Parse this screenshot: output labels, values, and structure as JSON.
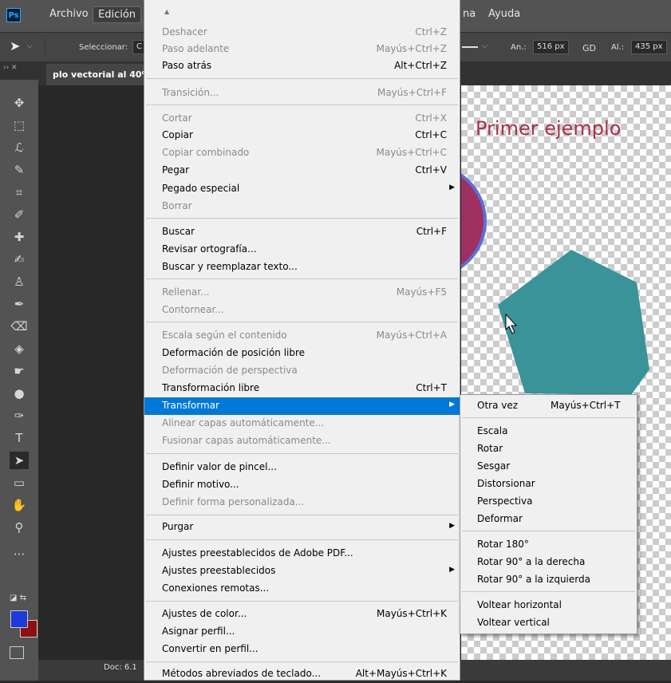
{
  "menubar": {
    "logo": "Ps",
    "items": [
      "Archivo",
      "Edición"
    ],
    "right_items": [
      "na",
      "Ayuda"
    ]
  },
  "options": {
    "select_label": "Seleccionar:",
    "select_value": "C",
    "width_label": "An.:",
    "width_value": "516 px",
    "link_icon": "GD",
    "height_label": "Al.:",
    "height_value": "435 px"
  },
  "document": {
    "tab_title": "plo vectorial al 40% (I",
    "canvas_title": "Primer ejemplo",
    "status": "Doc: 6.1"
  },
  "colors": {
    "foreground": "#1e3ad8",
    "background": "#8e1010",
    "hexagon": "#3a9399",
    "circle": "#9e3062",
    "circle_stroke": "#5b6fd6",
    "highlight": "#0078d7"
  },
  "main_menu": {
    "items": [
      {
        "label": "Deshacer",
        "shortcut": "Ctrl+Z",
        "disabled": true
      },
      {
        "label": "Paso adelante",
        "shortcut": "Mayús+Ctrl+Z",
        "disabled": true
      },
      {
        "label": "Paso atrás",
        "shortcut": "Alt+Ctrl+Z",
        "disabled": false
      },
      {
        "label": "Transición...",
        "shortcut": "Mayús+Ctrl+F",
        "disabled": true
      },
      {
        "label": "Cortar",
        "shortcut": "Ctrl+X",
        "disabled": true
      },
      {
        "label": "Copiar",
        "shortcut": "Ctrl+C",
        "disabled": false
      },
      {
        "label": "Copiar combinado",
        "shortcut": "Mayús+Ctrl+C",
        "disabled": true
      },
      {
        "label": "Pegar",
        "shortcut": "Ctrl+V",
        "disabled": false
      },
      {
        "label": "Pegado especial",
        "shortcut": "",
        "disabled": false,
        "submenu": true
      },
      {
        "label": "Borrar",
        "shortcut": "",
        "disabled": true
      },
      {
        "label": "Buscar",
        "shortcut": "Ctrl+F",
        "disabled": false
      },
      {
        "label": "Revisar ortografía...",
        "shortcut": "",
        "disabled": false
      },
      {
        "label": "Buscar y reemplazar texto...",
        "shortcut": "",
        "disabled": false
      },
      {
        "label": "Rellenar...",
        "shortcut": "Mayús+F5",
        "disabled": true
      },
      {
        "label": "Contornear...",
        "shortcut": "",
        "disabled": true
      },
      {
        "label": "Escala según el contenido",
        "shortcut": "Mayús+Ctrl+A",
        "disabled": true
      },
      {
        "label": "Deformación de posición libre",
        "shortcut": "",
        "disabled": false
      },
      {
        "label": "Deformación de perspectiva",
        "shortcut": "",
        "disabled": true
      },
      {
        "label": "Transformación libre",
        "shortcut": "Ctrl+T",
        "disabled": false
      },
      {
        "label": "Transformar",
        "shortcut": "",
        "disabled": false,
        "submenu": true,
        "highlighted": true
      },
      {
        "label": "Alinear capas automáticamente...",
        "shortcut": "",
        "disabled": true
      },
      {
        "label": "Fusionar capas automáticamente...",
        "shortcut": "",
        "disabled": true
      },
      {
        "label": "Definir valor de pincel...",
        "shortcut": "",
        "disabled": false
      },
      {
        "label": "Definir motivo...",
        "shortcut": "",
        "disabled": false
      },
      {
        "label": "Definir forma personalizada...",
        "shortcut": "",
        "disabled": true
      },
      {
        "label": "Purgar",
        "shortcut": "",
        "disabled": false,
        "submenu": true
      },
      {
        "label": "Ajustes preestablecidos de Adobe PDF...",
        "shortcut": "",
        "disabled": false
      },
      {
        "label": "Ajustes preestablecidos",
        "shortcut": "",
        "disabled": false,
        "submenu": true
      },
      {
        "label": "Conexiones remotas...",
        "shortcut": "",
        "disabled": false
      },
      {
        "label": "Ajustes de color...",
        "shortcut": "Mayús+Ctrl+K",
        "disabled": false
      },
      {
        "label": "Asignar perfil...",
        "shortcut": "",
        "disabled": false
      },
      {
        "label": "Convertir en perfil...",
        "shortcut": "",
        "disabled": false
      },
      {
        "label": "Métodos abreviados de teclado...",
        "shortcut": "Alt+Mayús+Ctrl+K",
        "disabled": false
      }
    ]
  },
  "transform_submenu": {
    "items": [
      {
        "label": "Otra vez",
        "shortcut": "Mayús+Ctrl+T"
      },
      {
        "label": "Escala",
        "shortcut": ""
      },
      {
        "label": "Rotar",
        "shortcut": ""
      },
      {
        "label": "Sesgar",
        "shortcut": ""
      },
      {
        "label": "Distorsionar",
        "shortcut": ""
      },
      {
        "label": "Perspectiva",
        "shortcut": ""
      },
      {
        "label": "Deformar",
        "shortcut": ""
      },
      {
        "label": "Rotar 180°",
        "shortcut": ""
      },
      {
        "label": "Rotar 90° a la derecha",
        "shortcut": ""
      },
      {
        "label": "Rotar 90° a la izquierda",
        "shortcut": ""
      },
      {
        "label": "Voltear horizontal",
        "shortcut": ""
      },
      {
        "label": "Voltear vertical",
        "shortcut": ""
      }
    ]
  },
  "tools": [
    "move-icon",
    "marquee-icon",
    "lasso-icon",
    "quick-select-icon",
    "crop-icon",
    "eyedropper-icon",
    "healing-brush-icon",
    "brush-icon",
    "clone-stamp-icon",
    "history-brush-icon",
    "eraser-icon",
    "paint-bucket-icon",
    "smudge-icon",
    "dodge-icon",
    "pen-icon",
    "type-icon",
    "path-select-icon",
    "rectangle-icon",
    "hand-icon",
    "zoom-icon",
    "more-tools-icon"
  ]
}
